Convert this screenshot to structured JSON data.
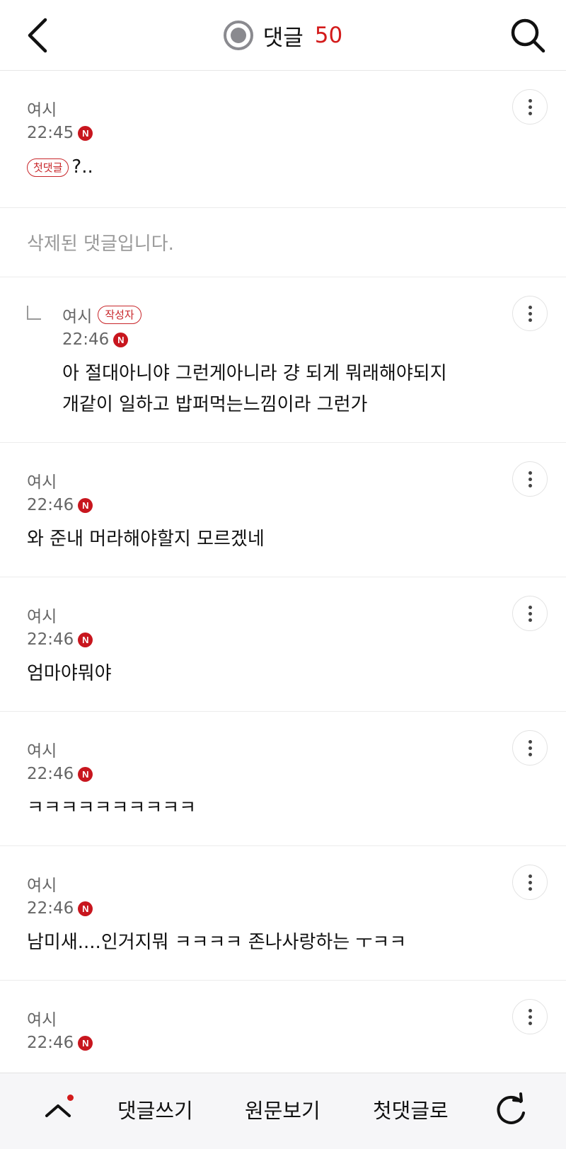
{
  "header": {
    "title": "댓글",
    "count": "50",
    "back_icon": "chevron-left-icon",
    "search_icon": "search-icon",
    "bell_icon": "bell-icon"
  },
  "badges": {
    "new": "N",
    "first_comment": "첫댓글",
    "writer": "작성자"
  },
  "comments": [
    {
      "author": "여시",
      "time": "22:45",
      "text": "?.."
    },
    {
      "deleted_text": "삭제된 댓글입니다."
    },
    {
      "author": "여시",
      "time": "22:46",
      "text_line1": "아 절대아니야 그런게아니라 걍 되게 뭐래해야되지",
      "text_line2": "개같이 일하고 밥퍼먹는느낌이라 그런가"
    },
    {
      "author": "여시",
      "time": "22:46",
      "text": "와 준내 머라해야할지 모르겠네"
    },
    {
      "author": "여시",
      "time": "22:46",
      "text": "엄마야뭐야"
    },
    {
      "author": "여시",
      "time": "22:46",
      "text": "ㅋㅋㅋㅋㅋㅋㅋㅋㅋㅋ"
    },
    {
      "author": "여시",
      "time": "22:46",
      "text": "남미새....인거지뭐 ㅋㅋㅋㅋ 존나사랑하는 ㅜㅋㅋ"
    },
    {
      "author": "여시",
      "time": "22:46"
    }
  ],
  "bottom_bar": {
    "write_label": "댓글쓰기",
    "original_label": "원문보기",
    "first_label": "첫댓글로",
    "scroll_top_icon": "chevron-up-icon",
    "refresh_icon": "refresh-icon"
  },
  "colors": {
    "accent": "#d31b1b",
    "muted_text": "#666666",
    "deleted_text": "#9a9a9a"
  }
}
